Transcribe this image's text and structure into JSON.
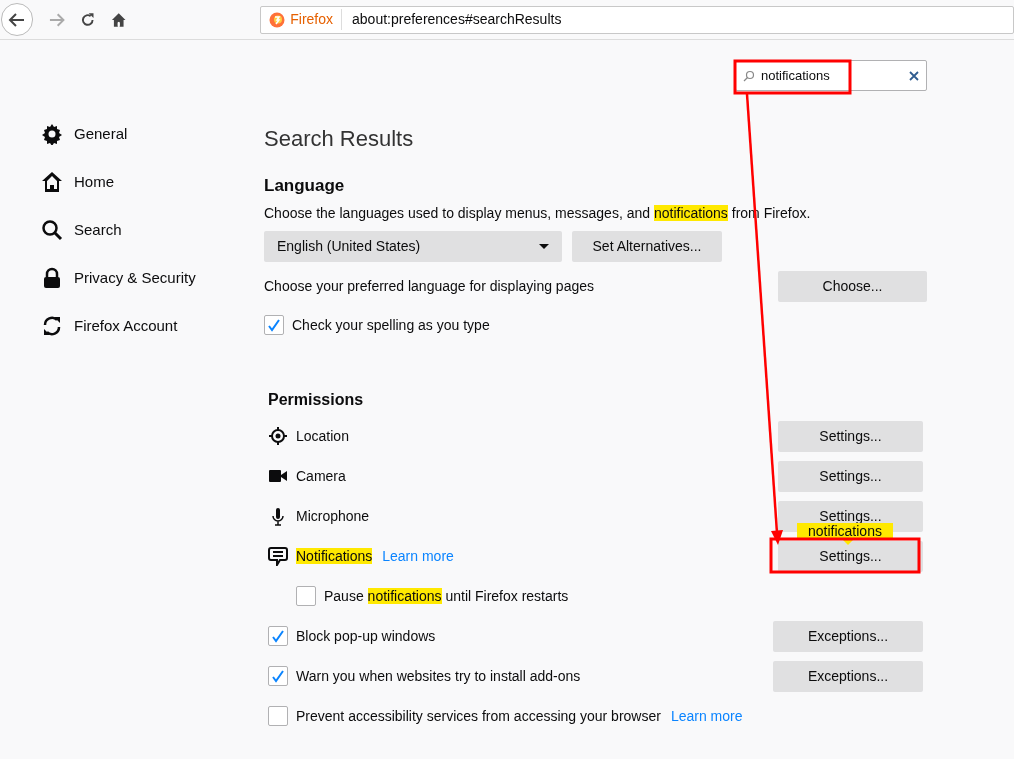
{
  "toolbar": {
    "identity": "Firefox",
    "url": "about:preferences#searchResults"
  },
  "search": {
    "value": "notifications"
  },
  "sidebar": {
    "items": [
      {
        "label": "General",
        "selected": false
      },
      {
        "label": "Home",
        "selected": false
      },
      {
        "label": "Search",
        "selected": false
      },
      {
        "label": "Privacy & Security",
        "selected": false
      },
      {
        "label": "Firefox Account",
        "selected": false
      }
    ]
  },
  "title": "Search Results",
  "language": {
    "heading": "Language",
    "description": [
      {
        "text": "Choose the languages used to display menus, messages, and ",
        "highlight": false
      },
      {
        "text": "notifications",
        "highlight": true
      },
      {
        "text": " from Firefox.",
        "highlight": false
      }
    ],
    "dropdown": "English (United States)",
    "alternatives_button": "Set Alternatives...",
    "pages_label": "Choose your preferred language for displaying pages",
    "choose_button": "Choose...",
    "spellcheck": {
      "label": "Check your spelling as you type",
      "checked": true
    }
  },
  "permissions": {
    "heading": "Permissions",
    "rows": [
      {
        "kind": "location",
        "label": [
          {
            "text": "Location",
            "highlight": false
          }
        ],
        "button": "Settings..."
      },
      {
        "kind": "camera",
        "label": [
          {
            "text": "Camera",
            "highlight": false
          }
        ],
        "button": "Settings..."
      },
      {
        "kind": "microphone",
        "label": [
          {
            "text": "Microphone",
            "highlight": false
          }
        ],
        "button": "Settings..."
      },
      {
        "kind": "notifications",
        "label": [
          {
            "text": "Notifications",
            "highlight": true
          }
        ],
        "link": "Learn more",
        "button": "Settings..."
      },
      {
        "kind": "sub-checkbox",
        "checked": false,
        "label": [
          {
            "text": "Pause ",
            "highlight": false
          },
          {
            "text": "notifications",
            "highlight": true
          },
          {
            "text": " until Firefox restarts",
            "highlight": false
          }
        ]
      },
      {
        "kind": "checkbox",
        "checked": true,
        "label": [
          {
            "text": "Block pop-up windows",
            "highlight": false
          }
        ],
        "button": "Exceptions..."
      },
      {
        "kind": "checkbox",
        "checked": true,
        "label": [
          {
            "text": "Warn you when websites try to install add-ons",
            "highlight": false
          }
        ],
        "button": "Exceptions..."
      },
      {
        "kind": "checkbox",
        "checked": false,
        "label": [
          {
            "text": "Prevent accessibility services from accessing your browser",
            "highlight": false
          }
        ],
        "link": "Learn more"
      }
    ]
  },
  "tooltip": "notifications"
}
